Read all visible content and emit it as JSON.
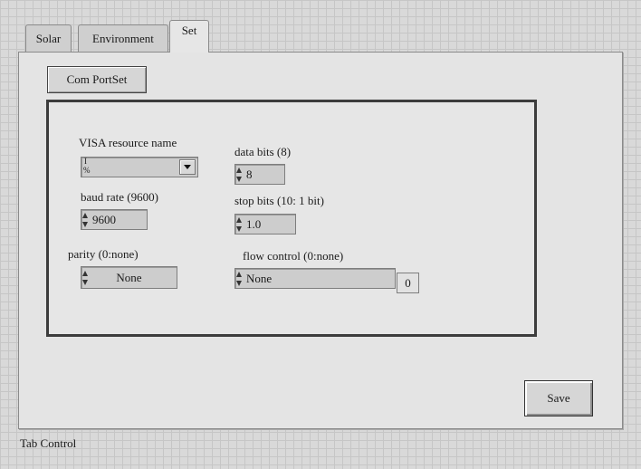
{
  "tabs": [
    {
      "label": "Solar",
      "active": false
    },
    {
      "label": "Environment",
      "active": false
    },
    {
      "label": "Set",
      "active": true
    }
  ],
  "panel": {
    "comport_button": "Com PortSet",
    "fields": {
      "visa": {
        "label": "VISA resource name",
        "spinner_top": "I",
        "spinner_bottom": "%",
        "value": ""
      },
      "baud": {
        "label": "baud rate (9600)",
        "value": "9600"
      },
      "parity": {
        "label": "parity (0:none)",
        "value": "None"
      },
      "data_bits": {
        "label": "data bits (8)",
        "value": "8"
      },
      "stop_bits": {
        "label": "stop bits (10: 1 bit)",
        "value": "1.0"
      },
      "flow": {
        "label": "flow control (0:none)",
        "value": "None",
        "index": "0"
      }
    },
    "save_button": "Save"
  },
  "caption": "Tab Control"
}
